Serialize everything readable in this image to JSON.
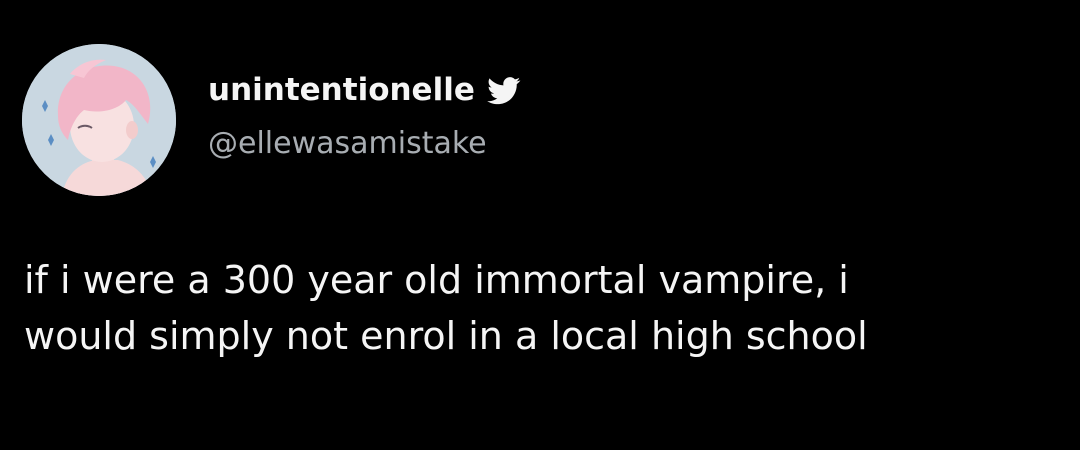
{
  "tweet": {
    "author": {
      "display_name": "unintentionelle",
      "handle": "@ellewasamistake",
      "verified_icon": "twitter-bird-icon",
      "avatar": "avatar"
    },
    "text_lines": [
      "if i were a 300 year old immortal vampire, i",
      "would simply not enrol in a local high school"
    ]
  },
  "colors": {
    "background": "#000000",
    "text": "#f5f5f5",
    "handle": "#a8adb2",
    "avatar_background": "#c9d7e1",
    "avatar_hair": "#f2b6c8"
  }
}
